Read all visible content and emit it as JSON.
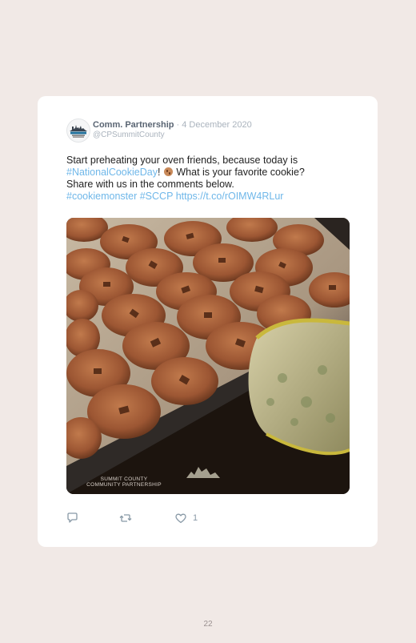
{
  "tweet": {
    "author_name": "Comm. Partnership",
    "separator": " · ",
    "date": "4 December 2020",
    "handle": "@CPSummitCounty",
    "text_line1": "Start preheating your oven friends, because today is",
    "hashtag_national": "#NationalCookieDay",
    "text_after_hashtag": "! ",
    "emoji": "cookie-emoji",
    "text_question": " What is your favorite cookie?",
    "text_line3": "Share with us in the comments below.",
    "hashtag_cookiemonster": "#cookiemonster",
    "hashtag_sccp": "#SCCP",
    "link": "https://t.co/rOIMW4RLur",
    "photo_watermark_line1": "SUMMIT COUNTY",
    "photo_watermark_line2": "COMMUNITY PARTNERSHIP",
    "like_count": "1"
  },
  "icons": [
    "reply-icon",
    "retweet-icon",
    "like-icon"
  ],
  "colors": {
    "link": "#6fb7e9",
    "name": "#5a6573",
    "meta": "#aab3bd",
    "background": "#f1e9e6"
  },
  "page_number": "22"
}
